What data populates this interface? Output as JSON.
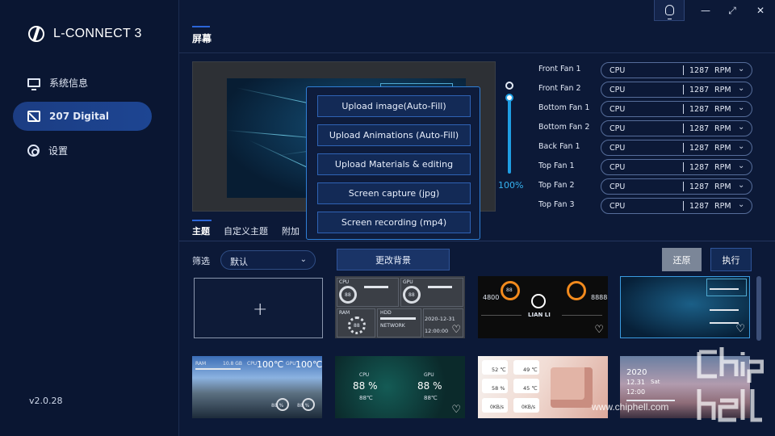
{
  "app": {
    "name": "L-CONNECT 3",
    "version": "v2.0.28"
  },
  "sidebar": {
    "items": [
      {
        "label": "系统信息",
        "icon": "monitor-icon"
      },
      {
        "label": "207 Digital",
        "icon": "screen-icon",
        "active": true
      },
      {
        "label": "设置",
        "icon": "gear-icon"
      }
    ]
  },
  "header": {
    "title": "屏幕"
  },
  "window_controls": {
    "minimize": "—",
    "maximize": "⤢",
    "close": "✕"
  },
  "brightness": {
    "value": "100%",
    "level": 1.0
  },
  "fans": [
    {
      "label": "Front Fan 1",
      "source": "CPU",
      "rpm": "1287",
      "unit": "RPM"
    },
    {
      "label": "Front Fan 2",
      "source": "CPU",
      "rpm": "1287",
      "unit": "RPM"
    },
    {
      "label": "Bottom Fan 1",
      "source": "CPU",
      "rpm": "1287",
      "unit": "RPM"
    },
    {
      "label": "Bottom Fan 2",
      "source": "CPU",
      "rpm": "1287",
      "unit": "RPM"
    },
    {
      "label": "Back Fan 1",
      "source": "CPU",
      "rpm": "1287",
      "unit": "RPM"
    },
    {
      "label": "Top Fan 1",
      "source": "CPU",
      "rpm": "1287",
      "unit": "RPM"
    },
    {
      "label": "Top Fan 2",
      "source": "CPU",
      "rpm": "1287",
      "unit": "RPM"
    },
    {
      "label": "Top Fan 3",
      "source": "CPU",
      "rpm": "1287",
      "unit": "RPM"
    }
  ],
  "popup": {
    "items": [
      "Upload image(Auto-Fill)",
      "Upload Animations (Auto-Fill)",
      "Upload Materials & editing",
      "Screen capture (jpg)",
      "Screen recording (mp4)"
    ]
  },
  "tabs": [
    {
      "label": "主题",
      "active": true
    },
    {
      "label": "自定义主题"
    },
    {
      "label": "附加"
    }
  ],
  "filter": {
    "label": "筛选",
    "value": "默认"
  },
  "buttons": {
    "change_bg": "更改背景",
    "restore": "还原",
    "execute": "执行"
  },
  "thumbs": {
    "t1": {
      "cpu": "CPU",
      "gpu": "GPU",
      "ram": "RAM",
      "hdd": "HDD",
      "network": "NETWORK",
      "v1": "88",
      "v2": "88",
      "v3": "88",
      "date": "2020-12-31",
      "time": "12:00:00"
    },
    "t2": {
      "brand": "LIAN LI",
      "v1": "4800",
      "v2": "88",
      "v3": "8888"
    },
    "t4": {
      "ram": "RAM",
      "ram_val": "10.8 GB",
      "cpu": "CPU",
      "cpu_temp": "100℃",
      "gpu": "GPU",
      "gpu_temp": "100℃",
      "u1": "88 %",
      "u2": "88 %"
    },
    "t5": {
      "cpu": "CPU",
      "gpu": "GPU",
      "p1": "88 %",
      "p2": "88 %",
      "t1": "88℃",
      "t2": "88℃"
    },
    "t6": {
      "cpu_temp": "52 ℃",
      "gpu_temp": "49 ℃",
      "ram": "58 %",
      "c2": "45 ℃",
      "d1": "0KB/s",
      "d2": "0KB/s"
    },
    "t7": {
      "year": "2020",
      "date": "12.31",
      "day": "Sat",
      "clock": "12:00"
    }
  },
  "watermark": {
    "text": "www.chiphell.com"
  }
}
